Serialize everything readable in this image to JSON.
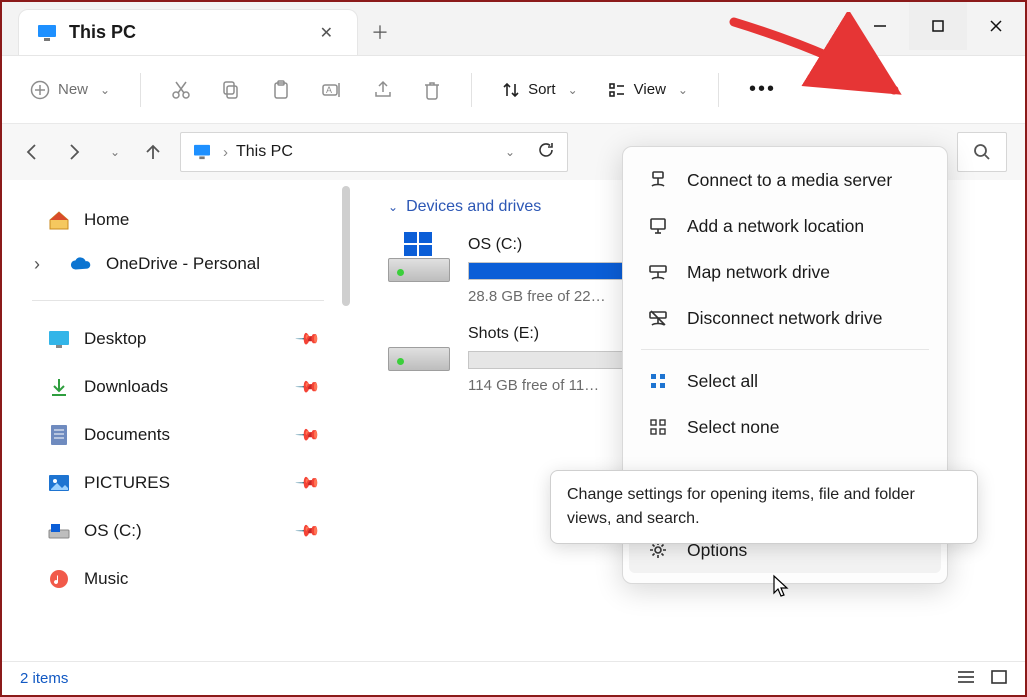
{
  "titlebar": {
    "tab_title": "This PC"
  },
  "cmdbar": {
    "new_label": "New",
    "sort_label": "Sort",
    "view_label": "View"
  },
  "address": {
    "crumb": "This PC"
  },
  "sidebar": {
    "home": "Home",
    "onedrive": "OneDrive - Personal",
    "quick": [
      {
        "label": "Desktop"
      },
      {
        "label": "Downloads"
      },
      {
        "label": "Documents"
      },
      {
        "label": "PICTURES"
      },
      {
        "label": "OS (C:)"
      },
      {
        "label": "Music"
      }
    ]
  },
  "content": {
    "section_title": "Devices and drives",
    "drives": [
      {
        "title": "OS (C:)",
        "sub": "28.8 GB free of 22…",
        "fill": 100
      },
      {
        "title": "Shots (E:)",
        "sub": "114 GB free of 11…",
        "fill": 0
      }
    ]
  },
  "ctx_menu": {
    "items": [
      {
        "label": "Connect to a media server"
      },
      {
        "label": "Add a network location"
      },
      {
        "label": "Map network drive"
      },
      {
        "label": "Disconnect network drive"
      }
    ],
    "select_items": [
      {
        "label": "Select all"
      },
      {
        "label": "Select none"
      }
    ],
    "options_label": "Options"
  },
  "tooltip": {
    "text": "Change settings for opening items, file and folder views, and search."
  },
  "status": {
    "text": "2 items"
  }
}
